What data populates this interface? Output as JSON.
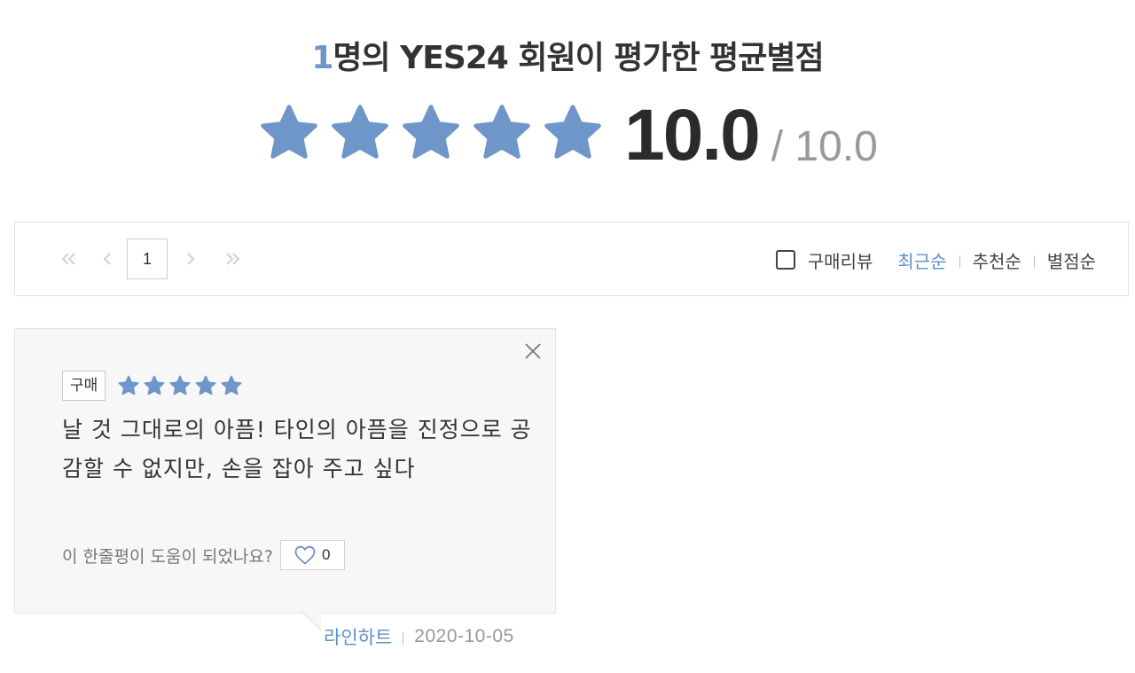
{
  "header": {
    "count": "1",
    "title_rest": "명의 YES24 회원이 평가한 평균별점",
    "score": "10.0",
    "score_max": "/ 10.0",
    "stars_filled": 5,
    "stars_total": 5,
    "star_color": "#6e96c8"
  },
  "pagination": {
    "first_icon": "double-chevron-left-icon",
    "prev_icon": "chevron-left-icon",
    "current_page": "1",
    "next_icon": "chevron-right-icon",
    "last_icon": "double-chevron-right-icon"
  },
  "sort": {
    "purchase_filter_label": "구매리뷰",
    "purchase_filter_checked": false,
    "options": [
      "최근순",
      "추천순",
      "별점순"
    ],
    "active": "최근순",
    "active_color": "#5f8fc4"
  },
  "review": {
    "badge": "구매",
    "stars_filled": 5,
    "text": "날 것 그대로의 아픔! 타인의 아픔을 진정으로 공감할 수 없지만, 손을 잡아 주고 싶다",
    "helpful_question": "이 한줄평이 도움이 되었나요?",
    "like_count": "0",
    "author": "라인하트",
    "date": "2020-10-05"
  }
}
